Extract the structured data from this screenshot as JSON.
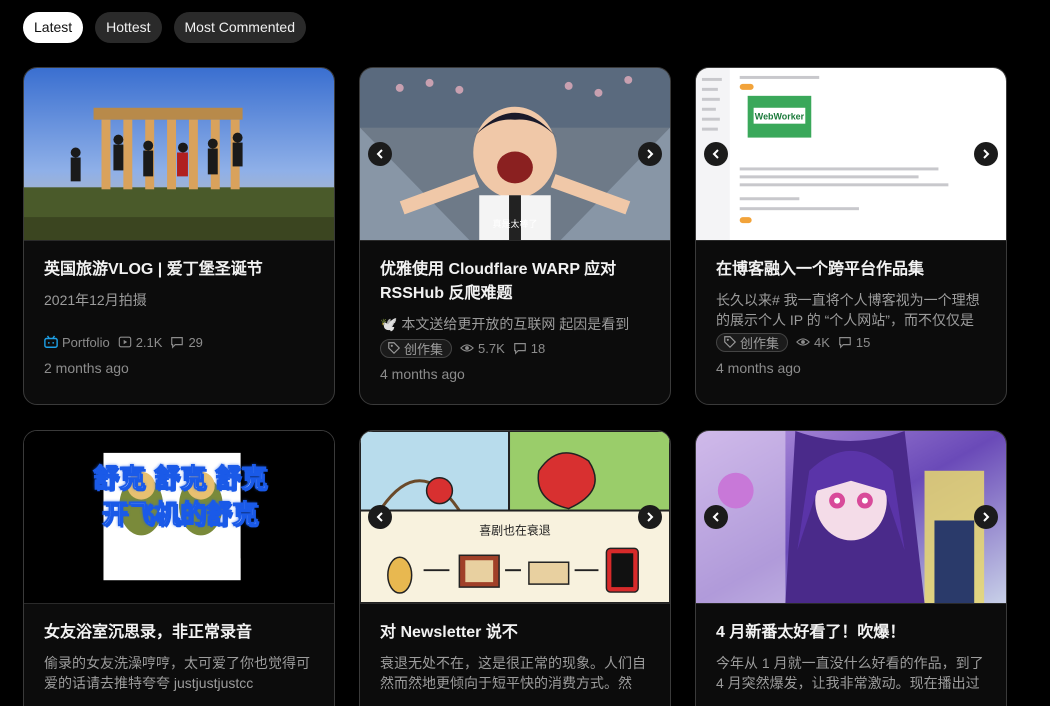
{
  "tabs": [
    {
      "label": "Latest",
      "active": true
    },
    {
      "label": "Hottest",
      "active": false
    },
    {
      "label": "Most Commented",
      "active": false
    }
  ],
  "cards": [
    {
      "title": "英国旅游VLOG | 爱丁堡圣诞节",
      "desc": "2021年12月拍摄",
      "category": "Portfolio",
      "views": "2.1K",
      "comments": "29",
      "time": "2 months ago"
    },
    {
      "title": "优雅使用 Cloudflare WARP 应对 RSSHub 反爬难题",
      "desc": "🕊️ 本文送给更开放的互联网 起因是看到",
      "category": "创作集",
      "views": "5.7K",
      "comments": "18",
      "time": "4 months ago"
    },
    {
      "title": "在博客融入一个跨平台作品集",
      "desc": "长久以来# 我一直将个人博客视为一个理想的展示个人 IP 的 “个人网站”，而不仅仅是",
      "category": "创作集",
      "views": "4K",
      "comments": "15",
      "time": "4 months ago"
    },
    {
      "title": "女友浴室沉思录，非正常录音",
      "desc": "偷录的女友洗澡哼哼，太可爱了你也觉得可爱的话请去推特夸夸  justjustjustcc",
      "thumb_text_1": "舒克 舒克 舒克",
      "thumb_text_2": "开飞机的舒克"
    },
    {
      "title": "对 Newsletter 说不",
      "desc": "衰退无处不在，这是很正常的现象。人们自然而然地更倾向于短平快的消费方式。然",
      "thumb_text": "喜剧也在衰退"
    },
    {
      "title": "4 月新番太好看了！吹爆！",
      "desc": "今年从 1 月就一直没什么好看的作品，到了 4 月突然爆发，让我非常激动。现在播出过"
    }
  ],
  "colors": {
    "background": "#000000",
    "card_border": "#3a3a3a",
    "bilibili_blue": "#1ea0e6",
    "tab_active_bg": "#ffffff"
  }
}
